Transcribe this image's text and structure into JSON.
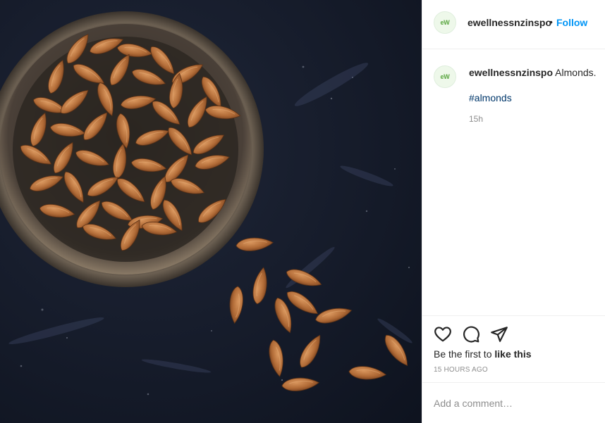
{
  "post": {
    "username": "ewellnessnzinspo",
    "avatar_text": "eW",
    "follow_label": "Follow",
    "separator": "•",
    "image_icon": "photo-almonds-in-bowl"
  },
  "caption": {
    "username": "ewellnessnzinspo",
    "text": "Almonds.",
    "hashtag": "#almonds",
    "time": "15h"
  },
  "actions": {
    "icons": [
      "heart-icon",
      "comment-icon",
      "share-icon"
    ],
    "likes_prefix": "Be the first to ",
    "likes_bold": "like this",
    "date": "15 HOURS AGO"
  },
  "comment": {
    "placeholder": "Add a comment…"
  },
  "colors": {
    "accent": "#0095f6",
    "hashtag": "#00376b",
    "muted": "#8e8e8e",
    "text": "#262626"
  }
}
